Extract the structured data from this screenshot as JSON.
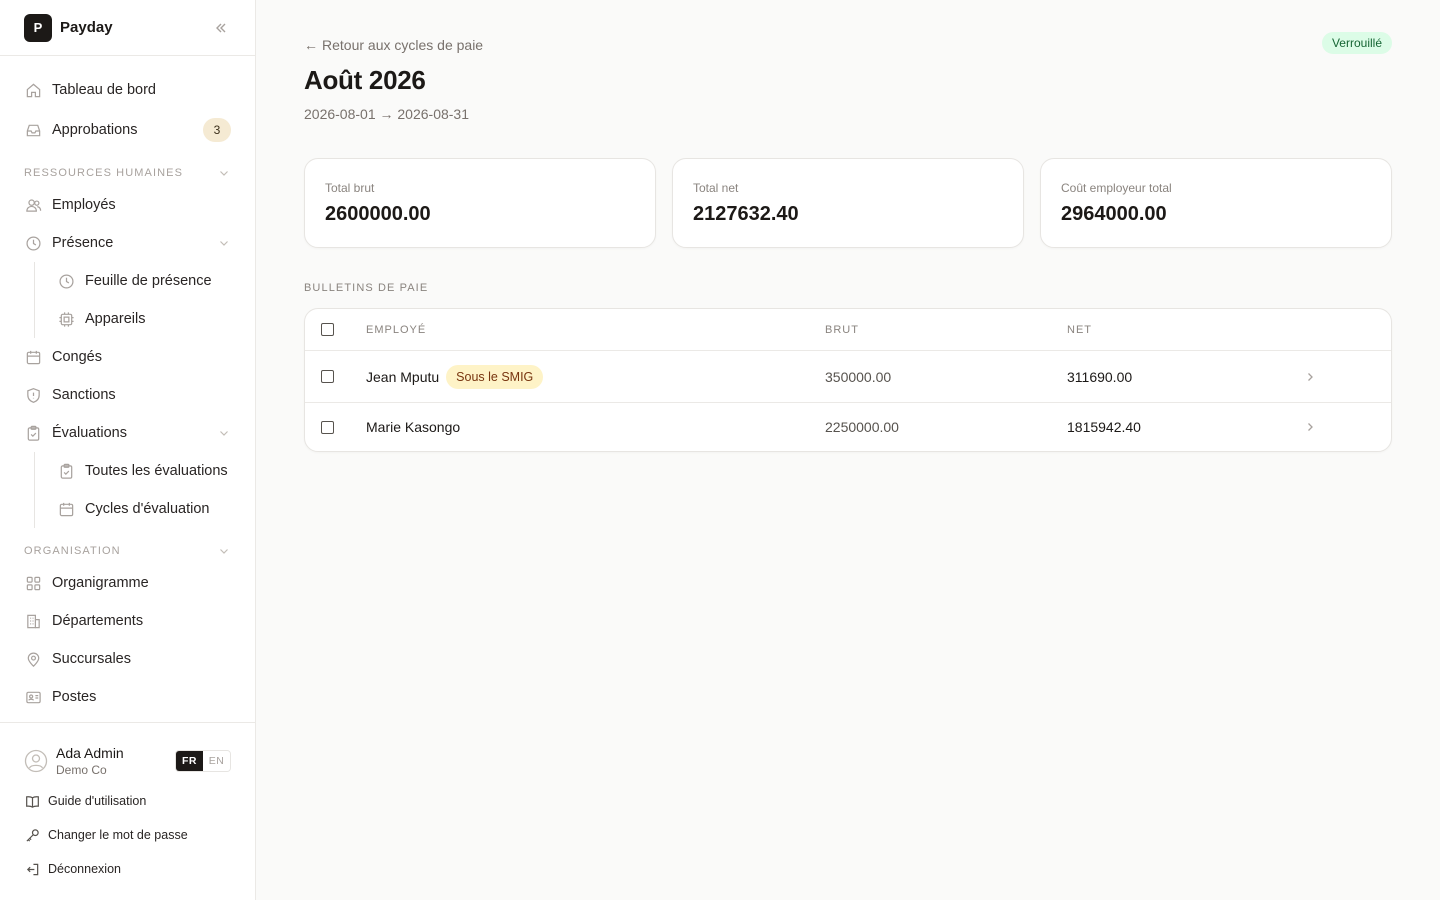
{
  "brand": {
    "logo_letter": "P",
    "name": "Payday"
  },
  "nav": {
    "dashboard": "Tableau de bord",
    "approvals": "Approbations",
    "approvals_count": "3",
    "hr_section": "RESSOURCES HUMAINES",
    "employees": "Employés",
    "presence": "Présence",
    "timesheet": "Feuille de présence",
    "devices": "Appareils",
    "leaves": "Congés",
    "sanctions": "Sanctions",
    "evaluations": "Évaluations",
    "all_evaluations": "Toutes les évaluations",
    "evaluation_cycles": "Cycles d'évaluation",
    "org_section": "ORGANISATION",
    "orgchart": "Organigramme",
    "departments": "Départements",
    "branches": "Succursales",
    "positions": "Postes"
  },
  "footer": {
    "user_name": "Ada Admin",
    "user_org": "Demo Co",
    "lang_fr": "FR",
    "lang_en": "EN",
    "guide": "Guide d'utilisation",
    "change_password": "Changer le mot de passe",
    "logout": "Déconnexion"
  },
  "page": {
    "back_arrow": "←",
    "back_label": "Retour aux cycles de paie",
    "status": "Verrouillé",
    "title": "Août 2026",
    "date_range": "2026-08-01 → 2026-08-31"
  },
  "cards": [
    {
      "label": "Total brut",
      "value": "2600000.00"
    },
    {
      "label": "Total net",
      "value": "2127632.40"
    },
    {
      "label": "Coût employeur total",
      "value": "2964000.00"
    }
  ],
  "payslips": {
    "section_title": "BULLETINS DE PAIE",
    "columns": {
      "employee": "EMPLOYÉ",
      "gross": "BRUT",
      "net": "NET"
    },
    "rows": [
      {
        "name": "Jean Mputu",
        "badge": "Sous le SMIG",
        "gross": "350000.00",
        "net": "311690.00"
      },
      {
        "name": "Marie Kasongo",
        "badge": "",
        "gross": "2250000.00",
        "net": "1815942.40"
      }
    ]
  },
  "colors": {
    "locked_bg": "#dcfce7",
    "locked_fg": "#166534",
    "smig_bg": "#fef3c7",
    "smig_fg": "#78350f",
    "approvals_badge_bg": "#f5ead3"
  }
}
